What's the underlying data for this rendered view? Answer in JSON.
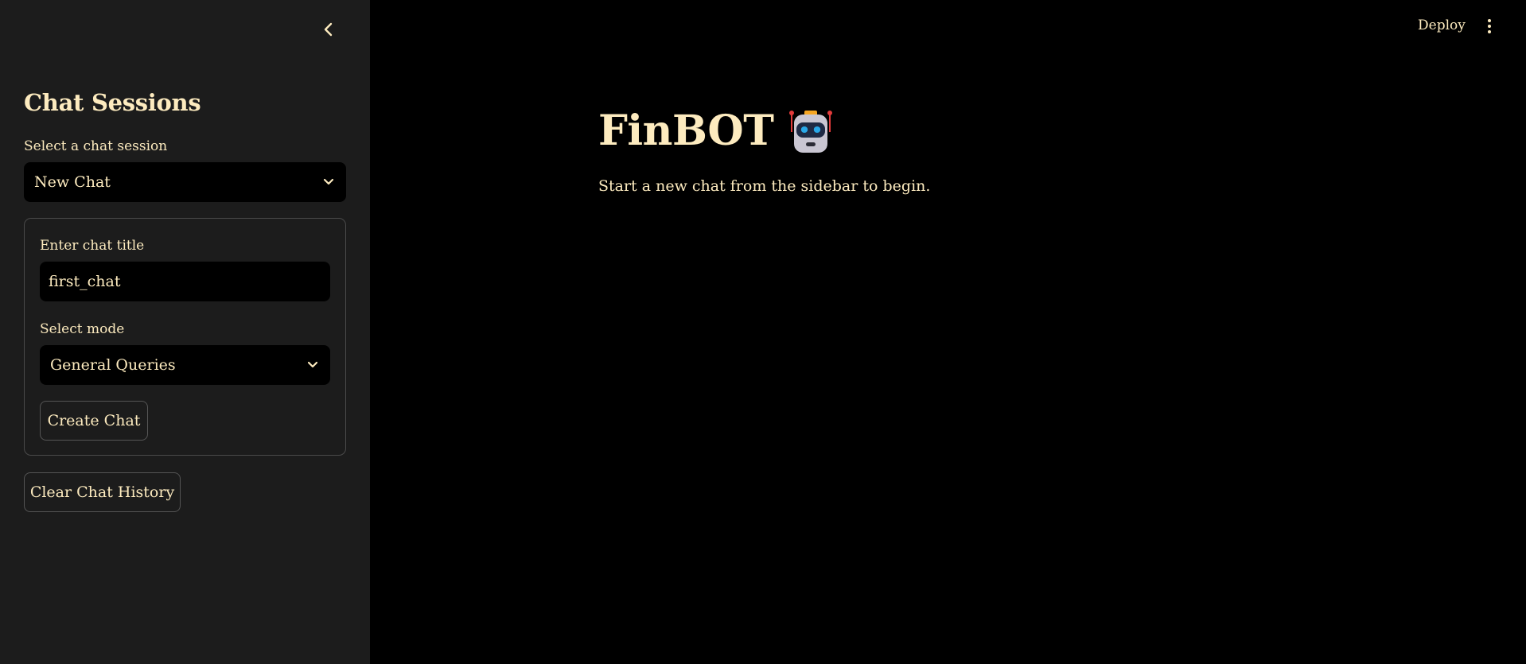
{
  "header": {
    "deploy_label": "Deploy"
  },
  "sidebar": {
    "title": "Chat Sessions",
    "session_select": {
      "label": "Select a chat session",
      "value": "New Chat"
    },
    "new_chat_form": {
      "title_label": "Enter chat title",
      "title_value": "first_chat",
      "mode_label": "Select mode",
      "mode_value": "General Queries",
      "create_button": "Create Chat"
    },
    "clear_button": "Clear Chat History"
  },
  "main": {
    "title": "FinBOT",
    "title_icon": "robot-face-icon",
    "subtitle": "Start a new chat from the sidebar to begin."
  },
  "colors": {
    "text": "#fdebbf",
    "sidebar_bg": "#1c1c1c",
    "main_bg": "#000000",
    "input_bg": "#000000"
  }
}
